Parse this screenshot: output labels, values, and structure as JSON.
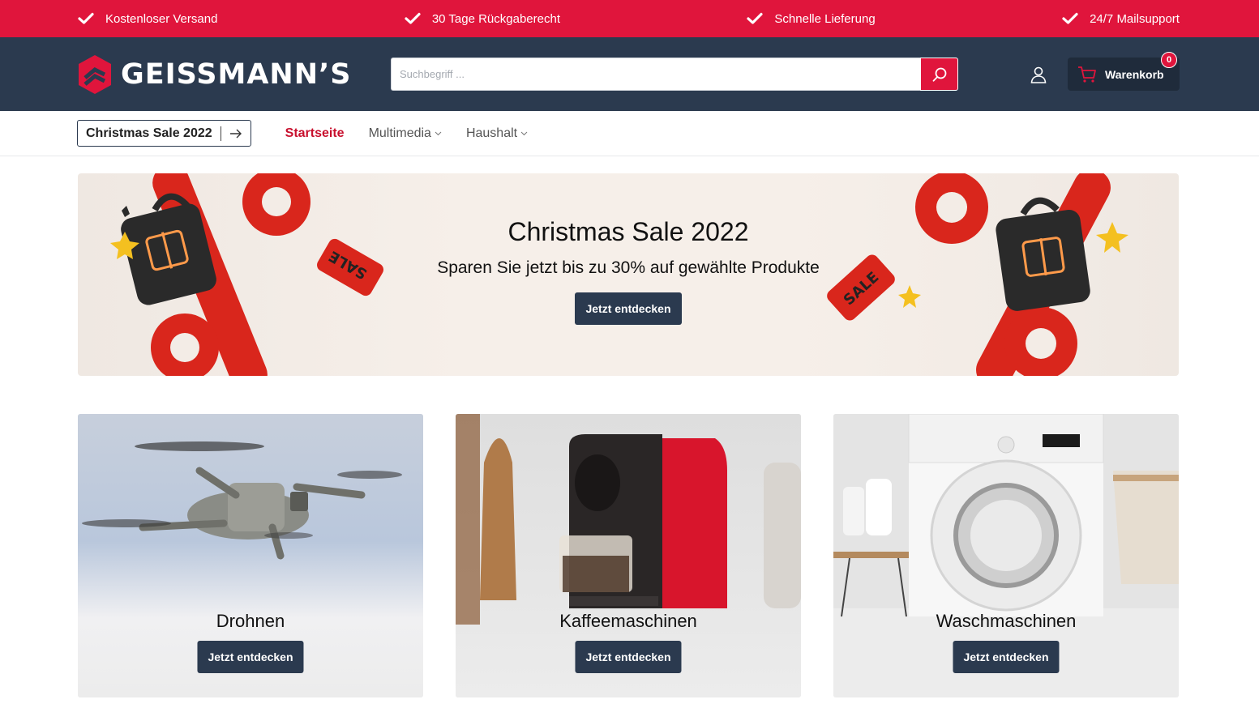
{
  "usp": [
    {
      "label": "Kostenloser Versand",
      "icon": "check-icon"
    },
    {
      "label": "30 Tage Rückgaberecht",
      "icon": "check-icon"
    },
    {
      "label": "Schnelle Lieferung",
      "icon": "check-icon"
    },
    {
      "label": "24/7 Mailsupport",
      "icon": "check-icon"
    }
  ],
  "header": {
    "logo_text": "GEISSMANN’S",
    "search_placeholder": "Suchbegriff ...",
    "cart_label": "Warenkorb",
    "cart_count": "0"
  },
  "nav": {
    "sale_label": "Christmas Sale 2022",
    "items": [
      {
        "label": "Startseite",
        "active": true
      },
      {
        "label": "Multimedia",
        "dropdown": true
      },
      {
        "label": "Haushalt",
        "dropdown": true
      }
    ]
  },
  "hero": {
    "title": "Christmas Sale 2022",
    "subtitle": "Sparen Sie jetzt bis zu 30% auf gewählte Produkte",
    "cta": "Jetzt entdecken",
    "tag_text": "SALE"
  },
  "categories": [
    {
      "title": "Drohnen",
      "cta": "Jetzt entdecken"
    },
    {
      "title": "Kaffeemaschinen",
      "cta": "Jetzt entdecken"
    },
    {
      "title": "Waschmaschinen",
      "cta": "Jetzt entdecken"
    }
  ],
  "colors": {
    "brand_red": "#e0153c",
    "header_navy": "#2b3a4f",
    "active_nav": "#c8102e"
  }
}
